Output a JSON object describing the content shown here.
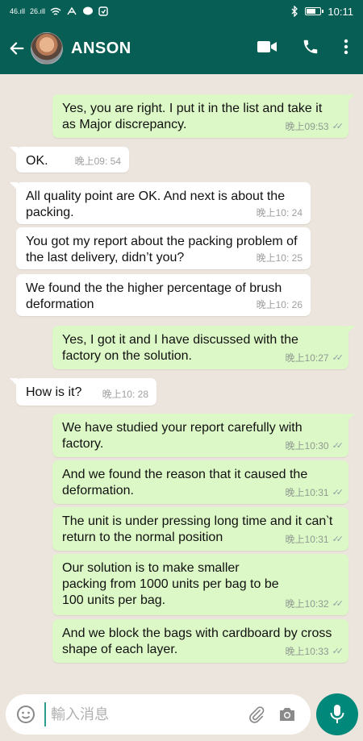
{
  "status_bar": {
    "signal_1": "46.ıll",
    "signal_2": "26.ıll",
    "time": "10:11"
  },
  "header": {
    "contact_name": "ANSON",
    "icons": [
      "back-arrow-icon",
      "video-call-icon",
      "phone-icon",
      "more-vert-icon"
    ]
  },
  "messages": [
    {
      "direction": "out",
      "text": "Yes, you are right. I put it in the list and take it as Major discrepancy.",
      "time": "晚上09:53"
    },
    {
      "direction": "in",
      "text": "OK.",
      "time": "晚上09: 54"
    },
    {
      "direction": "in",
      "text": "All quality point are OK. And next is about the packing.",
      "time": "晚上10: 24"
    },
    {
      "direction": "in",
      "text": "You got my report about the packing problem of the last delivery, didn’t you?",
      "time": "晚上10: 25"
    },
    {
      "direction": "in",
      "text": "We found the the higher percentage of brush deformation",
      "time": "晚上10: 26"
    },
    {
      "direction": "out",
      "text": "Yes, I got it and I have discussed with the factory on the solution.",
      "time": "晚上10:27"
    },
    {
      "direction": "in",
      "text": "How is it?",
      "time": "晚上10: 28"
    },
    {
      "direction": "out",
      "text": "We have studied your report carefully with factory.",
      "time": "晚上10:30"
    },
    {
      "direction": "out",
      "text": "And we found the reason that it caused the deformation.",
      "time": "晚上10:31"
    },
    {
      "direction": "out",
      "text": "The unit is under pressing long time and it can‵t return to the normal position",
      "time": "晚上10:31"
    },
    {
      "direction": "out",
      "text": "Our solution is to make smaller packing from 1000 units per bag to be 100 units per bag.",
      "time": "晚上10:32"
    },
    {
      "direction": "out",
      "text": "And we block the bags with cardboard by cross shape of each layer.",
      "time": "晚上10:33"
    }
  ],
  "input": {
    "placeholder": "輸入消息"
  },
  "colors": {
    "header": "#075e54",
    "outgoing_bubble": "#dcf8c6",
    "incoming_bubble": "#ffffff",
    "chat_background": "#ece5dd",
    "mic_button": "#00897b"
  }
}
